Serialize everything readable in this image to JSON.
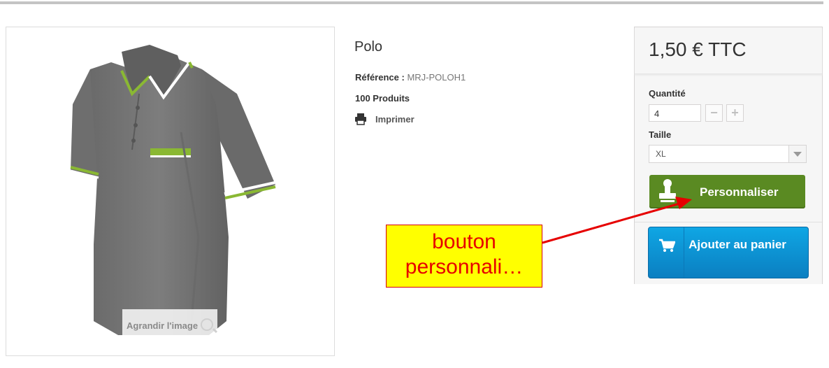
{
  "product": {
    "title": "Polo",
    "reference_label": "Référence :",
    "reference_value": "MRJ-POLOH1",
    "quantity_text": "100 Produits",
    "print_label": "Imprimer",
    "zoom_label": "Agrandir l'image",
    "image_icon": "polo-shirt-image"
  },
  "buybox": {
    "price": "1,50 € TTC",
    "quantity_label": "Quantité",
    "quantity_value": "4",
    "minus_label": "−",
    "plus_label": "+",
    "size_label": "Taille",
    "size_selected": "XL",
    "personalize_label": "Personnaliser",
    "personalize_icon": "stamp-icon",
    "cart_label": "Ajouter au panier",
    "cart_icon": "cart-icon",
    "personalize_color": "#5a8a22",
    "cart_color": "#0b8fd3"
  },
  "annotation": {
    "text": "bouton personnali…",
    "background": "#ffff00",
    "text_color": "#e60000"
  }
}
